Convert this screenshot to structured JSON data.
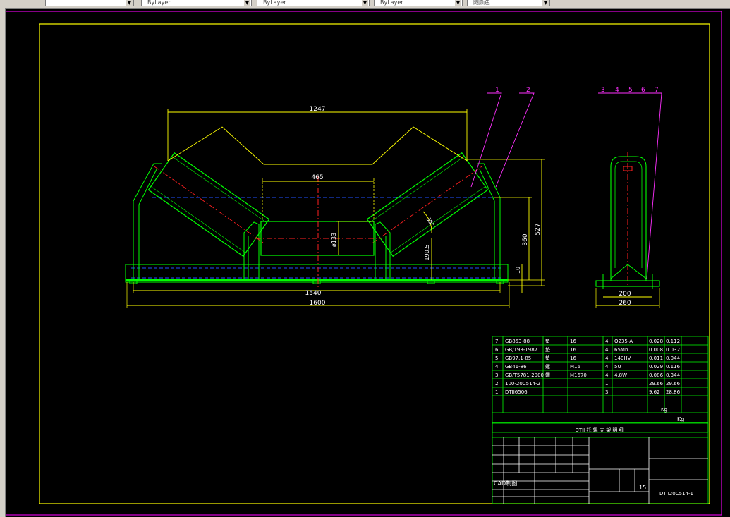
{
  "toolbar": {
    "combos": [
      {
        "value": "",
        "icon": "layer-icon"
      },
      {
        "value": "ByLayer"
      },
      {
        "value": "ByLayer"
      },
      {
        "value": "ByLayer"
      },
      {
        "value": "随颜色"
      }
    ]
  },
  "colors": {
    "frame": "#e000e0",
    "border": "#ffff00",
    "outline": "#00ff00",
    "dim": "#ffff00",
    "axis": "#ff2020",
    "hidden": "#2050ff",
    "leader": "#ff30ff",
    "grid": "#ffffff"
  },
  "front_view": {
    "dim_overall_top": "1247",
    "dim_center_roller": "465",
    "dim_diameter": "ø133",
    "dim_center_height": "190.5",
    "dim_angle": "35°",
    "dim_height_inner": "360",
    "dim_height_total": "527",
    "dim_base": "10",
    "dim_span_mid": "1540",
    "dim_span_total": "1600"
  },
  "side_view": {
    "dim_inner": "200",
    "dim_outer": "260"
  },
  "balloons": {
    "front": [
      "1",
      "2"
    ],
    "side": [
      "3",
      "4",
      "5",
      "6",
      "7"
    ]
  },
  "bom": {
    "rows": [
      {
        "no": "7",
        "code": "GB853-88",
        "name": "垫",
        "spec": "16",
        "qty": "4",
        "mat": "Q235-A",
        "unit": "0.028",
        "total": "0.112"
      },
      {
        "no": "6",
        "code": "GB/T93-1987",
        "name": "垫",
        "spec": "16",
        "qty": "4",
        "mat": "65Mn",
        "unit": "0.008",
        "total": "0.032"
      },
      {
        "no": "5",
        "code": "GB97.1-85",
        "name": "垫",
        "spec": "16",
        "qty": "4",
        "mat": "140HV",
        "unit": "0.011",
        "total": "0.044"
      },
      {
        "no": "4",
        "code": "GB41-86",
        "name": "螺",
        "spec": "M16",
        "qty": "4",
        "mat": "5U",
        "unit": "0.029",
        "total": "0.116"
      },
      {
        "no": "3",
        "code": "GB/T5781-2000",
        "name": "螺",
        "spec": "M1670",
        "qty": "4",
        "mat": "4.8W",
        "unit": "0.086",
        "total": "0.344"
      },
      {
        "no": "2",
        "code": "100-20C514-2",
        "name": "",
        "spec": "",
        "qty": "1",
        "mat": "",
        "unit": "29.66",
        "total": "29.66"
      },
      {
        "no": "1",
        "code": "DTII6506",
        "name": "",
        "spec": "",
        "qty": "3",
        "mat": "",
        "unit": "9.62",
        "total": "28.86"
      }
    ],
    "header_kg": "Kg",
    "total_kg": "Kg",
    "title_line": "DTII 托 辊 支 架 明 细",
    "cad_label": "CAD制图",
    "scale": "15",
    "drawing_no": "DTII20C514-1"
  }
}
